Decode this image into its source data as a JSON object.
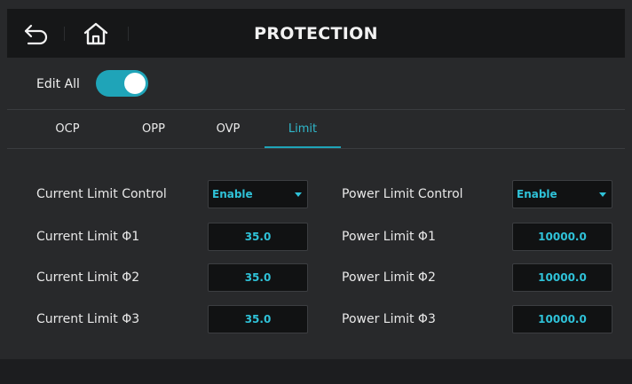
{
  "header": {
    "title": "PROTECTION",
    "back_icon": "back-arrow-icon",
    "home_icon": "home-icon"
  },
  "edit_all": {
    "label": "Edit All",
    "enabled": true
  },
  "tabs": [
    {
      "label": "OCP",
      "active": false
    },
    {
      "label": "OPP",
      "active": false
    },
    {
      "label": "OVP",
      "active": false
    },
    {
      "label": "Limit",
      "active": true
    }
  ],
  "current": {
    "control_label": "Current Limit Control",
    "control_value": "Enable",
    "limits": [
      {
        "label": "Current Limit Φ1",
        "value": "35.0"
      },
      {
        "label": "Current Limit Φ2",
        "value": "35.0"
      },
      {
        "label": "Current Limit Φ3",
        "value": "35.0"
      }
    ]
  },
  "power": {
    "control_label": "Power Limit Control",
    "control_value": "Enable",
    "limits": [
      {
        "label": "Power Limit Φ1",
        "value": "10000.0"
      },
      {
        "label": "Power Limit Φ2",
        "value": "10000.0"
      },
      {
        "label": "Power Limit Φ3",
        "value": "10000.0"
      }
    ]
  },
  "colors": {
    "accent": "#1fa4b8",
    "value_text": "#2fc2d8",
    "header_bg": "#161718",
    "panel_bg": "#28292b"
  }
}
